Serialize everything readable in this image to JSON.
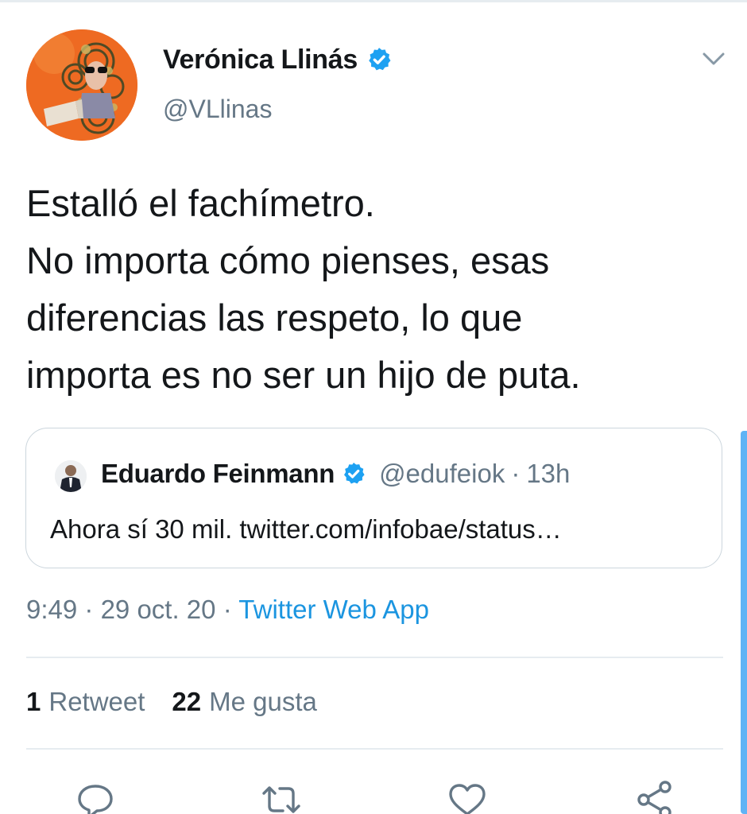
{
  "tweet": {
    "author_name": "Verónica Llinás",
    "author_handle": "@VLlinas",
    "text_lines": [
      "Estalló el fachímetro.",
      "No importa cómo pienses, esas",
      "diferencias las respeto, lo que",
      "importa es no ser un hijo de puta."
    ],
    "time": "9:49",
    "date": "29 oct. 20",
    "separator": "·",
    "source": "Twitter Web App"
  },
  "quoted_tweet": {
    "author_name": "Eduardo Feinmann",
    "author_handle": "@edufeiok",
    "age": "13h",
    "separator": "·",
    "text": "Ahora sí 30 mil. twitter.com/infobae/status…"
  },
  "stats": {
    "retweets_count": "1",
    "retweets_label": "Retweet",
    "likes_count": "22",
    "likes_label": "Me gusta"
  },
  "actions": [
    "reply-icon",
    "retweet-icon",
    "like-icon",
    "share-icon"
  ],
  "colors": {
    "text": "#14171a",
    "secondary": "#657786",
    "link": "#1b95e0",
    "verified": "#1da1f2",
    "divider": "#e6ecf0"
  }
}
